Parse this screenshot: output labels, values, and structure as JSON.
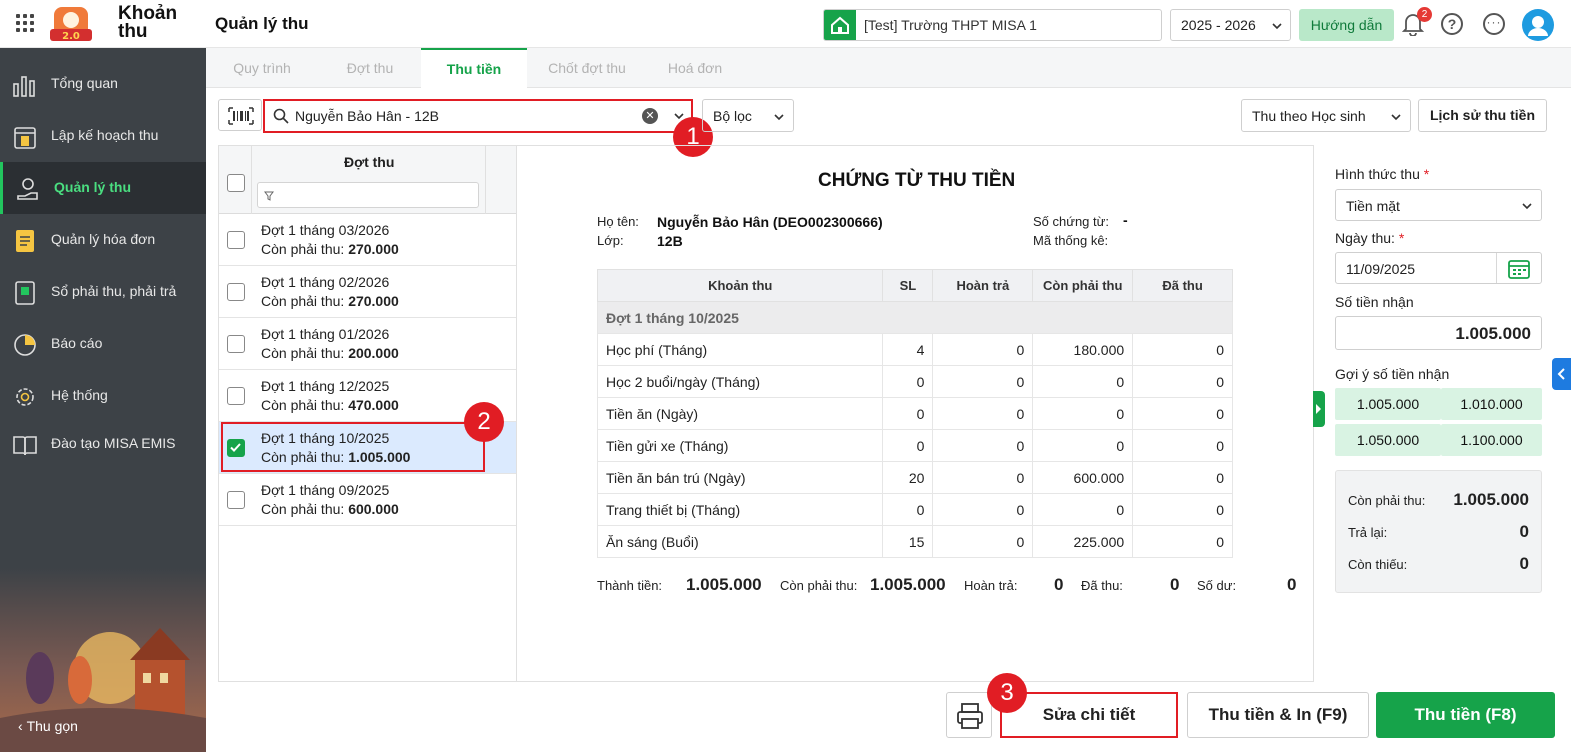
{
  "app": {
    "name": "Khoản thu",
    "logo_text": "2.0",
    "page_title": "Quản lý thu"
  },
  "header": {
    "school": "[Test] Trường THPT MISA 1",
    "year": "2025 - 2026",
    "guide_label": "Hướng dẫn",
    "notification_count": "2",
    "help": "?",
    "more": "···"
  },
  "sidebar": {
    "items": [
      {
        "label": "Tổng quan",
        "icon": "chart-icon"
      },
      {
        "label": "Lập kế hoạch thu",
        "icon": "calendar-dollar-icon"
      },
      {
        "label": "Quản lý thu",
        "icon": "hand-coin-icon"
      },
      {
        "label": "Quản lý hóa đơn",
        "icon": "invoice-icon"
      },
      {
        "label": "Sổ phải thu, phải trả",
        "icon": "ledger-icon"
      },
      {
        "label": "Báo cáo",
        "icon": "pie-icon"
      },
      {
        "label": "Hệ thống",
        "icon": "gear-icon"
      },
      {
        "label": "Đào tạo MISA EMIS",
        "icon": "book-icon"
      }
    ],
    "collapse_label": "Thu gọn"
  },
  "tabs": [
    "Quy trình",
    "Đợt thu",
    "Thu tiền",
    "Chốt đợt thu",
    "Hoá đơn"
  ],
  "toolbar": {
    "search_value": "Nguyễn Bảo Hân - 12B",
    "filter_label": "Bộ lọc",
    "mode_label": "Thu theo Học sinh",
    "history_label": "Lịch sử thu tiền"
  },
  "callouts": [
    "1",
    "2",
    "3"
  ],
  "list": {
    "header": "Đợt thu",
    "remaining_label": "Còn phải thu:",
    "rows": [
      {
        "name": "Đợt 1 tháng 03/2026",
        "amount": "270.000"
      },
      {
        "name": "Đợt 1 tháng 02/2026",
        "amount": "270.000"
      },
      {
        "name": "Đợt 1 tháng 01/2026",
        "amount": "200.000"
      },
      {
        "name": "Đợt 1 tháng 12/2025",
        "amount": "470.000"
      },
      {
        "name": "Đợt 1 tháng 10/2025",
        "amount": "1.005.000"
      },
      {
        "name": "Đợt 1 tháng 09/2025",
        "amount": "600.000"
      }
    ]
  },
  "doc": {
    "title": "CHỨNG TỪ THU TIỀN",
    "name_label": "Họ tên:",
    "name_value": "Nguyễn Bảo Hân (DEO002300666)",
    "class_label": "Lớp:",
    "class_value": "12B",
    "voucher_label": "Số chứng từ:",
    "voucher_value": "-",
    "stat_label": "Mã thống kê:",
    "columns": [
      "Khoản thu",
      "SL",
      "Hoàn trả",
      "Còn phải thu",
      "Đã thu"
    ],
    "group": "Đợt 1 tháng 10/2025",
    "rows": [
      [
        "Học phí (Tháng)",
        "4",
        "0",
        "180.000",
        "0"
      ],
      [
        "Học 2 buổi/ngày (Tháng)",
        "0",
        "0",
        "0",
        "0"
      ],
      [
        "Tiền ăn (Ngày)",
        "0",
        "0",
        "0",
        "0"
      ],
      [
        "Tiền gửi xe (Tháng)",
        "0",
        "0",
        "0",
        "0"
      ],
      [
        "Tiền ăn bán trú (Ngày)",
        "20",
        "0",
        "600.000",
        "0"
      ],
      [
        "Trang thiết bị (Tháng)",
        "0",
        "0",
        "0",
        "0"
      ],
      [
        "Ăn sáng (Buổi)",
        "15",
        "0",
        "225.000",
        "0"
      ]
    ],
    "totals": {
      "total_label": "Thành tiền:",
      "total_value": "1.005.000",
      "remaining_label": "Còn phải thu:",
      "remaining_value": "1.005.000",
      "refund_label": "Hoàn trả:",
      "refund_value": "0",
      "paid_label": "Đã thu:",
      "paid_value": "0",
      "balance_label": "Số dư:",
      "balance_value": "0"
    }
  },
  "payment": {
    "method_label": "Hình thức thu",
    "method_value": "Tiền mặt",
    "date_label": "Ngày thu:",
    "date_value": "11/09/2025",
    "amount_label": "Số tiền nhận",
    "amount_value": "1.005.000",
    "suggest_label": "Gợi ý số tiền nhận",
    "suggestions": [
      "1.005.000",
      "1.010.000",
      "1.050.000",
      "1.100.000"
    ],
    "required_mark": "*",
    "summary": {
      "remaining_label": "Còn phải thu:",
      "remaining_value": "1.005.000",
      "return_label": "Trả lại:",
      "return_value": "0",
      "short_label": "Còn thiếu:",
      "short_value": "0"
    }
  },
  "buttons": {
    "edit": "Sửa chi tiết",
    "pay_print": "Thu tiền & In (F9)",
    "pay": "Thu tiền (F8)"
  },
  "colors": {
    "accent": "#16a34a",
    "highlight": "#e11d24",
    "sidebar": "#3d4247"
  }
}
